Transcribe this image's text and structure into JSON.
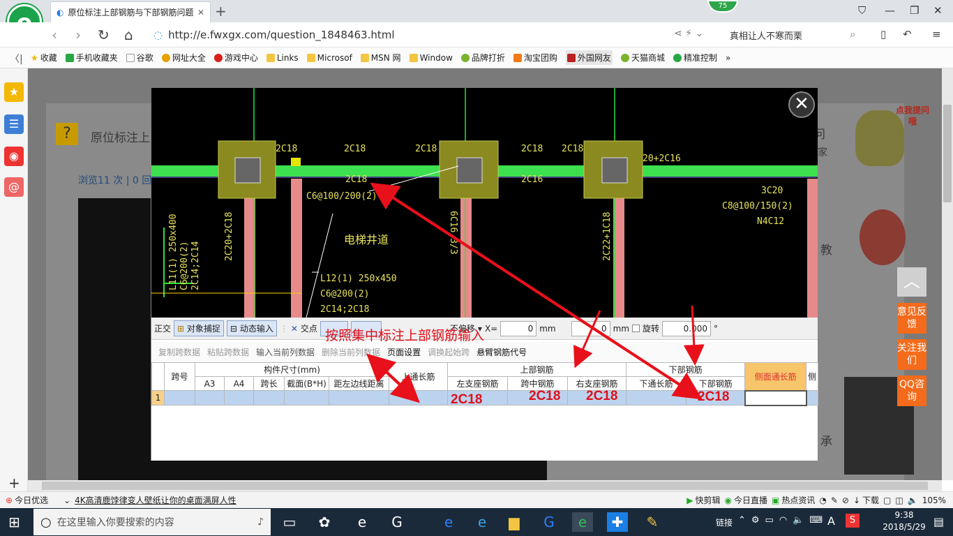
{
  "browser": {
    "tab_title": "原位标注上部钢筋与下部钢筋问题",
    "badge": "75",
    "url": "http://e.fwxgx.com/question_1848463.html",
    "search_text": "真相让人不寒而栗",
    "bookmarks": [
      "收藏",
      "手机收藏夹",
      "谷歌",
      "网址大全",
      "游戏中心",
      "Links",
      "Microsof",
      "MSN 网",
      "Window",
      "品牌打折",
      "淘宝团购",
      "外国网友",
      "天猫商城",
      "精准控制"
    ],
    "page_title": "原位标注上",
    "page_stats": "浏览11 次 | 0 回",
    "right_bg_1": "问",
    "right_bg_2": "家",
    "right_bg_3": "教",
    "right_bg_4": "承",
    "bubble": "点我提问哦"
  },
  "cad": {
    "labels": {
      "t1": "2C18",
      "t2": "2C18",
      "t3": "2C18",
      "t4": "2C18",
      "t5": "2C18",
      "t6": "20+2C16",
      "t7": "2C18",
      "t8": "2C16",
      "t9": "C6@100/200(2)",
      "t10": "电梯井道",
      "t11": "3C20",
      "t12": "C8@100/150(2)",
      "t13": "N4C12",
      "t14": "2C20+2C18",
      "t15": "6C16 3/3",
      "t16": "2C22+1C18",
      "t17": "L12(1) 250x450",
      "t18": "C6@200(2)",
      "t19": "2C14;2C18",
      "t20": "L11(1) 250x400",
      "t21": "C6@200(2)",
      "t22": "2C14;2C14"
    }
  },
  "toolbar1": {
    "ortho": "正交",
    "snap": "对象捕捉",
    "dyn": "动态输入",
    "intersect": "交点",
    "rotate_lbl": "不偏移",
    "x_lbl": "X=",
    "x_val": "0",
    "mm1": "mm",
    "y_val": "0",
    "mm2": "mm",
    "rot_lbl": "旋转",
    "rot_val": "0.000",
    "deg": "°"
  },
  "toolbar2": {
    "copy": "复制跨数据",
    "paste": "粘贴跨数据",
    "input_col": "输入当前列数据",
    "del_col": "删除当前列数据",
    "page_setup": "页面设置",
    "swap": "调换起始跨",
    "cantilever": "悬臂钢筋代号"
  },
  "grid": {
    "span_no": "跨号",
    "dim": "构件尺寸(mm)",
    "a3": "A3",
    "a4": "A4",
    "span_len": "跨长",
    "section": "截面(B*H)",
    "dist": "距左边线距离",
    "top_through": "上通长筋",
    "top_group": "上部钢筋",
    "left_seat": "左支座钢筋",
    "mid_span": "跨中钢筋",
    "right_seat": "右支座钢筋",
    "bot_group": "下部钢筋",
    "bot_through": "下通长筋",
    "bot_bar": "下部钢筋",
    "side_bar": "侧面通长筋",
    "cut": "侧",
    "row1": "1"
  },
  "annotations": {
    "main": "按照集中标注上部钢筋输入",
    "v1": "2C18",
    "v2": "2C18",
    "v3": "2C18",
    "v4": "2C18"
  },
  "float_btns": [
    "意见反馈",
    "关注我们",
    "QQ咨询"
  ],
  "status": {
    "youxuan": "今日优选",
    "news": "4K高清鹿饽律变人壁纸让你的桌面满屏人性",
    "kuai": "快剪辑",
    "zhibo": "今日直播",
    "redian": "热点资讯",
    "download": "下载",
    "zoom": "105%"
  },
  "taskbar": {
    "search": "在这里输入你要搜索的内容",
    "link": "链接",
    "ime": "A",
    "time": "9:38",
    "date": "2018/5/29"
  }
}
